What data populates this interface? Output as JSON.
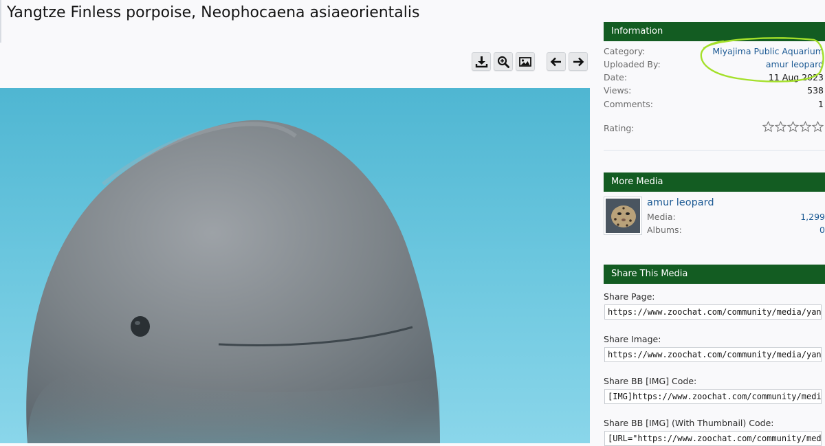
{
  "page": {
    "title": "Yangtze Finless porpoise, Neophocaena asiaeorientalis"
  },
  "toolbar": {
    "buttons": [
      {
        "icon": "download-icon"
      },
      {
        "icon": "zoom-in-icon"
      },
      {
        "icon": "image-icon"
      },
      {
        "icon": "arrow-left-icon"
      },
      {
        "icon": "arrow-right-icon"
      }
    ]
  },
  "information": {
    "heading": "Information",
    "category_label": "Category:",
    "category_value": "Miyajima Public Aquarium",
    "uploaded_label": "Uploaded By:",
    "uploaded_value": "amur leopard",
    "date_label": "Date:",
    "date_value": "11 Aug 2023",
    "views_label": "Views:",
    "views_value": "538",
    "comments_label": "Comments:",
    "comments_value": "1",
    "rating_label": "Rating:",
    "rating_stars": 0,
    "rating_max": 5
  },
  "more_media": {
    "heading": "More Media",
    "user": "amur leopard",
    "media_label": "Media:",
    "media_value": "1,299",
    "albums_label": "Albums:",
    "albums_value": "0"
  },
  "share": {
    "heading": "Share This Media",
    "page_label": "Share Page:",
    "page_value": "https://www.zoochat.com/community/media/yangtz",
    "image_label": "Share Image:",
    "image_value": "https://www.zoochat.com/community/media/yangtz",
    "bb_label": "Share BB [IMG] Code:",
    "bb_value": "[IMG]https://www.zoochat.com/community/media/y",
    "bb_thumb_label": "Share BB [IMG] (With Thumbnail) Code:",
    "bb_thumb_value": "[URL=\"https://www.zoochat.com/community/media/"
  },
  "colors": {
    "header_green": "#135c22",
    "link_blue": "#1c5a94",
    "highlight": "#a4e02a",
    "water": "#5bbfd8"
  }
}
